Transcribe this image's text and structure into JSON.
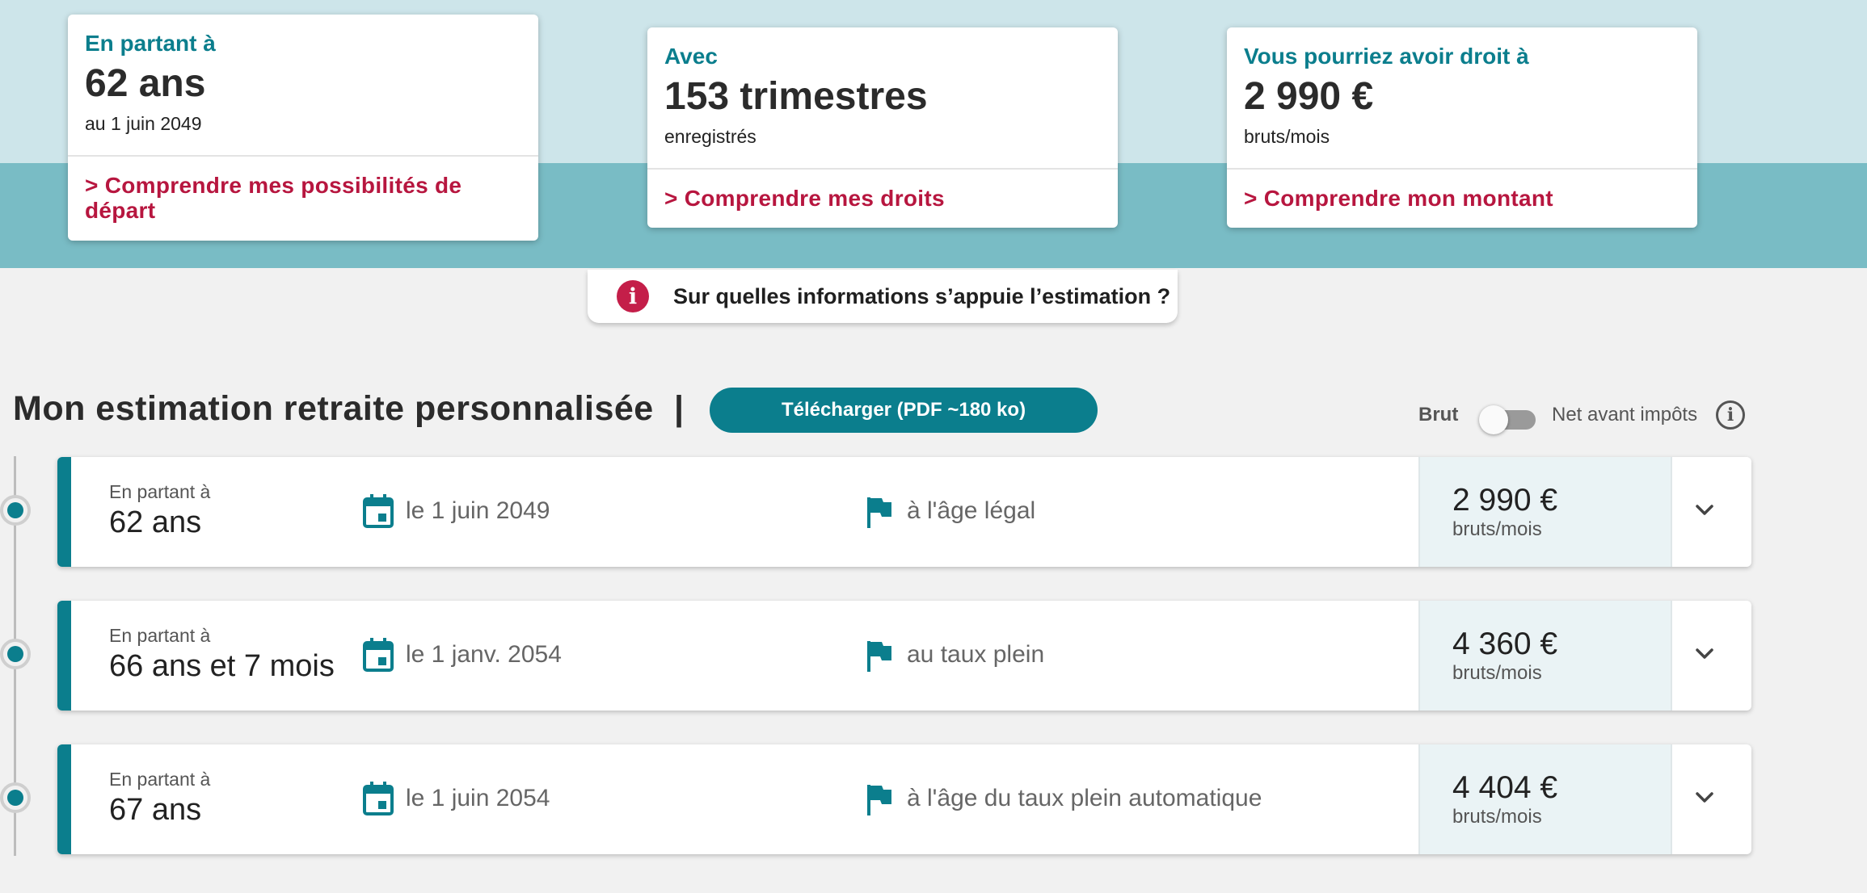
{
  "summary_cards": [
    {
      "label": "En partant à",
      "value": "62 ans",
      "sub": "au 1 juin 2049",
      "link": "> Comprendre mes possibilités de départ"
    },
    {
      "label": "Avec",
      "value": "153 trimestres",
      "sub": "enregistrés",
      "link": "> Comprendre mes droits"
    },
    {
      "label": "Vous pourriez avoir droit à",
      "value": "2 990 €",
      "sub": "bruts/mois",
      "link": "> Comprendre mon montant"
    }
  ],
  "info_banner": {
    "icon": "info-icon",
    "text": "Sur quelles informations s’appuie l’estimation ?"
  },
  "section": {
    "title": "Mon estimation retraite personnalisée",
    "separator": "|",
    "download_label": "Télécharger (PDF ~180 ko)",
    "toggle": {
      "left_label": "Brut",
      "right_label": "Net avant impôts",
      "state": "Brut"
    }
  },
  "rows": [
    {
      "prefix": "En partant à",
      "age": "62 ans",
      "date": "le 1 juin 2049",
      "reason": "à l'âge légal",
      "amount": "2 990 €",
      "unit": "bruts/mois"
    },
    {
      "prefix": "En partant à",
      "age": "66 ans et 7 mois",
      "date": "le 1 janv. 2054",
      "reason": "au taux plein",
      "amount": "4 360 €",
      "unit": "bruts/mois"
    },
    {
      "prefix": "En partant à",
      "age": "67 ans",
      "date": "le 1 juin 2054",
      "reason": "à l'âge du taux plein automatique",
      "amount": "4 404 €",
      "unit": "bruts/mois"
    }
  ],
  "colors": {
    "accent": "#0b7e8d",
    "link": "#b7163f",
    "band_light": "#cde5ea",
    "band_dark": "#79bcc5"
  }
}
